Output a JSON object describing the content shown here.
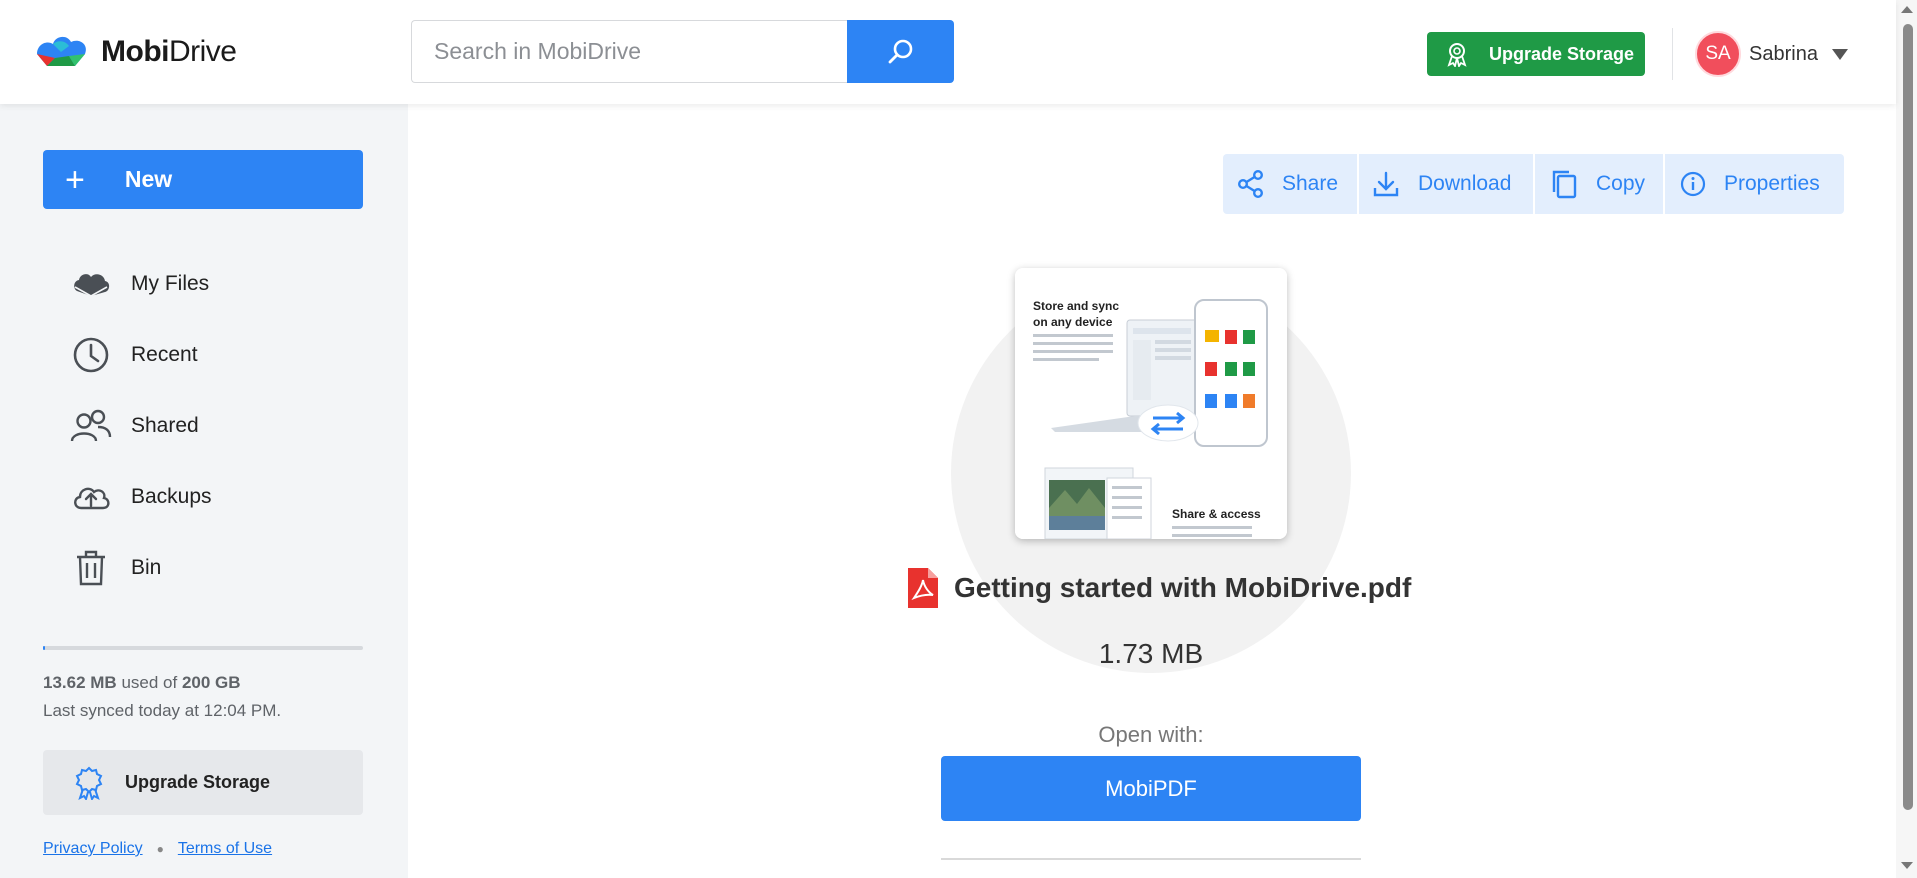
{
  "app": {
    "name_bold": "Mobi",
    "name_rest": "Drive"
  },
  "search": {
    "placeholder": "Search in MobiDrive"
  },
  "header": {
    "upgrade_label": "Upgrade Storage",
    "user_initials": "SA",
    "user_name": "Sabrina"
  },
  "sidebar": {
    "new_label": "New",
    "items": [
      {
        "label": "My Files",
        "icon": "cloud-icon"
      },
      {
        "label": "Recent",
        "icon": "clock-icon"
      },
      {
        "label": "Shared",
        "icon": "users-icon"
      },
      {
        "label": "Backups",
        "icon": "cloud-upload-icon"
      },
      {
        "label": "Bin",
        "icon": "trash-icon"
      }
    ],
    "storage": {
      "used": "13.62 MB",
      "used_of": "used of",
      "total": "200 GB",
      "fill_percent": 0.68,
      "synced": "Last synced today at 12:04 PM."
    },
    "upgrade_label": "Upgrade Storage",
    "privacy": "Privacy Policy",
    "terms": "Terms of Use"
  },
  "toolbar": {
    "share": "Share",
    "download": "Download",
    "copy": "Copy",
    "properties": "Properties"
  },
  "file": {
    "name": "Getting started with MobiDrive.pdf",
    "size": "1.73 MB",
    "open_with_label": "Open with:",
    "open_app": "MobiPDF",
    "thumb_heading": "Store and sync on any device",
    "thumb_subheading": "Share & access"
  },
  "colors": {
    "primary": "#2d84f4",
    "upgrade_green": "#1f9a46",
    "avatar": "#f14e5c",
    "pdf_red": "#e8322e"
  }
}
